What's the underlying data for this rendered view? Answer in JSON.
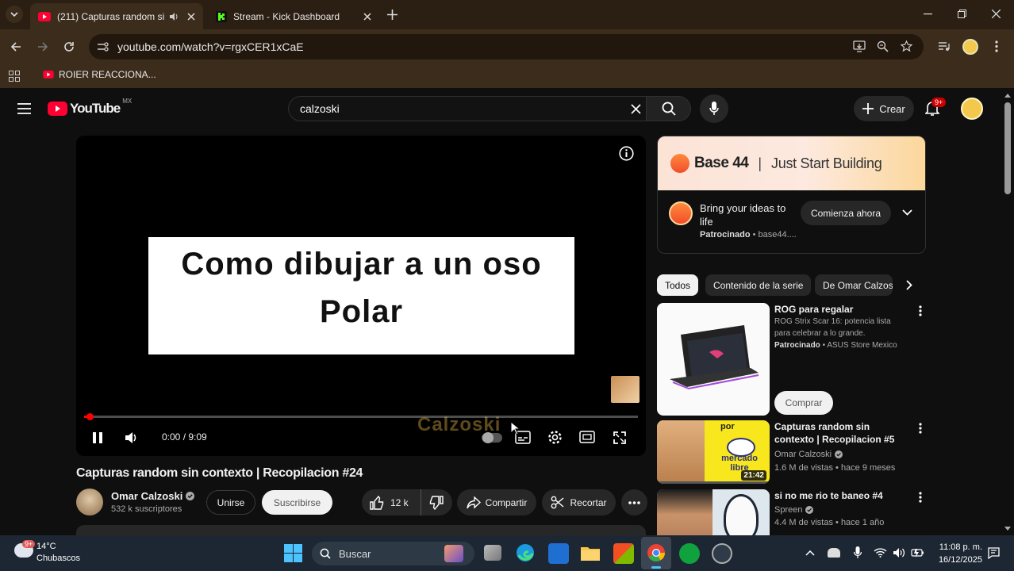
{
  "browser": {
    "tabs": [
      {
        "title": "(211) Capturas random sin c",
        "active": true
      },
      {
        "title": "Stream - Kick Dashboard",
        "active": false
      }
    ],
    "url": "youtube.com/watch?v=rgxCER1xCaE",
    "bookmark": "ROIER REACCIONA..."
  },
  "youtube": {
    "logo": "YouTube",
    "region": "MX",
    "search_value": "calzoski",
    "create_label": "Crear",
    "notifications_badge": "9+"
  },
  "player": {
    "slide_line1": "Como dibujar a un oso",
    "slide_line2": "Polar",
    "watermark": "Calzoski",
    "time": "0:00 / 9:09",
    "progress": 0.01
  },
  "video": {
    "title": "Capturas random sin contexto | Recopilacion #24",
    "channel": "Omar Calzoski",
    "subscribers": "532 k suscriptores",
    "join_label": "Unirse",
    "subscribe_label": "Suscribirse",
    "likes": "12 k",
    "share_label": "Compartir",
    "clip_label": "Recortar"
  },
  "ad": {
    "banner_brand": "Base 44",
    "banner_tagline": "Just Start Building",
    "headline": "Bring your ideas to life",
    "sponsored": "Patrocinado",
    "domain": "base44....",
    "cta": "Comienza ahora"
  },
  "chips": [
    "Todos",
    "Contenido de la serie",
    "De Omar Calzos"
  ],
  "recommendations": [
    {
      "title": "ROG para regalar",
      "desc": "ROG Strix Scar 16: potencia lista para celebrar a lo grande.",
      "sponsored": "Patrocinado",
      "advertiser": "ASUS Store Mexico",
      "cta": "Comprar"
    },
    {
      "title": "Capturas random sin contexto | Recopilacion #5",
      "channel": "Omar Calzoski",
      "meta": "1.6 M de vistas • hace 9 meses",
      "duration": "21:42",
      "thumb_text_top": "por",
      "thumb_text_bottom": "mercado libre"
    },
    {
      "title": "si no me rio te baneo #4",
      "channel": "Spreen",
      "meta": "4.4 M de vistas • hace 1 año"
    }
  ],
  "taskbar": {
    "weather_temp": "14°C",
    "weather_desc": "Chubascos",
    "weather_badge": "9+",
    "search_label": "Buscar",
    "time": "11:08 p. m.",
    "date": "16/12/2025"
  }
}
